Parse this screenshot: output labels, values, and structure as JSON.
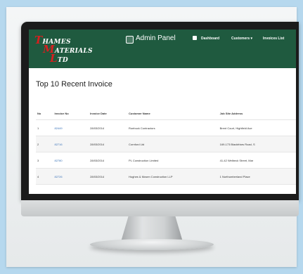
{
  "header": {
    "logo_lines": [
      {
        "cap": "T",
        "rest": "HAMES"
      },
      {
        "cap": "M",
        "rest": "ATERIALS"
      },
      {
        "cap": "L",
        "rest": "TD"
      }
    ],
    "title": "Admin Panel",
    "nav": [
      {
        "label": "Dashboard"
      },
      {
        "label": "Customers ▾"
      },
      {
        "label": "Invoices List"
      }
    ]
  },
  "page": {
    "title": "Top 10 Recent Invoice"
  },
  "table": {
    "columns": [
      "No",
      "Invoice No",
      "Invoice Date",
      "Customer Name",
      "Job Site Address"
    ],
    "rows": [
      [
        "1",
        "82449",
        "28/03/2014",
        "Roebuck Contractors",
        "Brent Court, Highfield Ave"
      ],
      [
        "2",
        "82716",
        "28/03/2014",
        "Cornford Ltd",
        "169-173 Blackfriars Road, S"
      ],
      [
        "3",
        "82780",
        "28/03/2014",
        "PL Construction Limited",
        "41-42 Welbeck Street, Mar"
      ],
      [
        "4",
        "82726",
        "28/03/2014",
        "Hughes & Mosen Construction LLP",
        "1 Northumberland Place"
      ]
    ]
  },
  "colors": {
    "header_bg": "#1f5a3f",
    "logo_accent": "#d61f1f",
    "link": "#3b73b9",
    "background": "#b6d8ee"
  }
}
